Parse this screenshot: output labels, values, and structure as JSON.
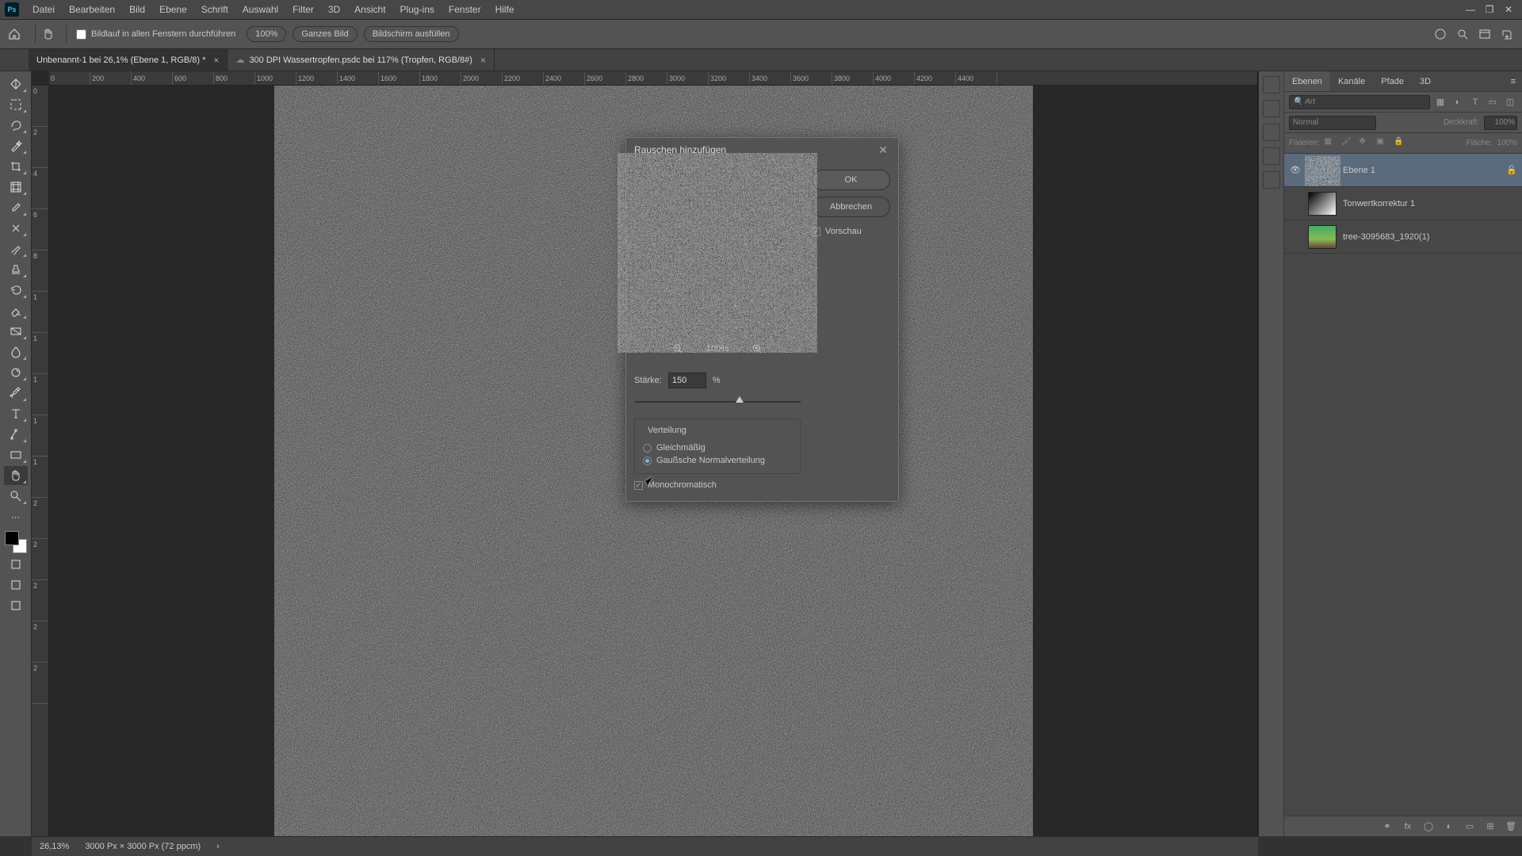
{
  "app": {
    "logo": "Ps"
  },
  "menu": [
    "Datei",
    "Bearbeiten",
    "Bild",
    "Ebene",
    "Schrift",
    "Auswahl",
    "Filter",
    "3D",
    "Ansicht",
    "Plug-ins",
    "Fenster",
    "Hilfe"
  ],
  "options": {
    "scroll_all": "Bildlauf in allen Fenstern durchführen",
    "b100": "100%",
    "bfit": "Ganzes Bild",
    "bfill": "Bildschirm ausfüllen"
  },
  "tabs": [
    {
      "label": "Unbenannt-1 bei 26,1% (Ebene 1, RGB/8) *",
      "active": true
    },
    {
      "label": "300 DPI Wassertropfen.psdc bei 117% (Tropfen, RGB/8#)",
      "active": false,
      "cloud": true
    }
  ],
  "ruler_h": [
    "0",
    "200",
    "400",
    "600",
    "800",
    "1000",
    "1200",
    "1400",
    "1600",
    "1800",
    "2000",
    "2200",
    "2400",
    "2600",
    "2800",
    "3000",
    "3200",
    "3400",
    "3600",
    "3800",
    "4000",
    "4200",
    "4400"
  ],
  "ruler_v": [
    "0",
    "2",
    "4",
    "6",
    "8",
    "1",
    "1",
    "1",
    "1",
    "1",
    "2",
    "2",
    "2",
    "2",
    "2"
  ],
  "panels": {
    "tabs": [
      "Ebenen",
      "Kanäle",
      "Pfade",
      "3D"
    ],
    "search_ph": "Art",
    "blend": {
      "mode": "Normal",
      "opacity_label": "Deckkraft:",
      "opacity_value": "100%"
    },
    "lock": {
      "label": "Fixieren:",
      "fill_label": "Fläche:",
      "fill_value": "100%"
    },
    "layers": [
      {
        "name": "Ebene 1",
        "visible": true,
        "selected": true,
        "thumb": "noise"
      },
      {
        "name": "Tonwertkorrektur 1",
        "visible": false,
        "selected": false,
        "thumb": "adjust"
      },
      {
        "name": "tree-3095683_1920(1)",
        "visible": false,
        "selected": false,
        "thumb": "image"
      }
    ]
  },
  "status": {
    "zoom": "26,13%",
    "info": "3000 Px × 3000 Px (72 ppcm)"
  },
  "dialog": {
    "title": "Rauschen hinzufügen",
    "ok": "OK",
    "cancel": "Abbrechen",
    "preview": "Vorschau",
    "zoom": "100%",
    "amount_label": "Stärke:",
    "amount_value": "150",
    "amount_unit": "%",
    "dist_title": "Verteilung",
    "dist_uniform": "Gleichmäßig",
    "dist_gauss": "Gaußsche Normalverteilung",
    "dist_selected": "gauss",
    "mono": "Monochromatisch",
    "mono_checked": true,
    "preview_checked": true
  }
}
